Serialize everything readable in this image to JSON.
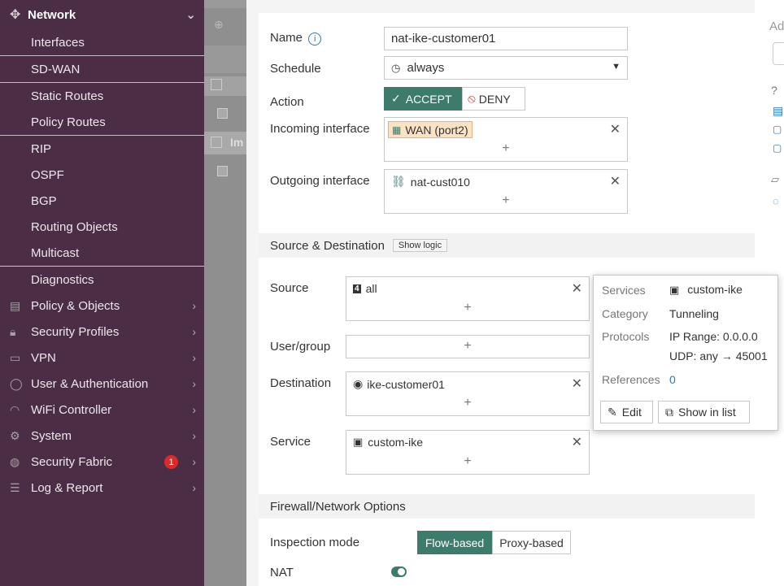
{
  "sidebar": {
    "section_title": "Network",
    "sub_items": [
      "Interfaces",
      "SD-WAN",
      "Static Routes",
      "Policy Routes",
      "RIP",
      "OSPF",
      "BGP",
      "Routing Objects",
      "Multicast",
      "Diagnostics"
    ],
    "top_items": [
      {
        "label": "Policy & Objects",
        "icon": "policy-icon"
      },
      {
        "label": "Security Profiles",
        "icon": "lock-icon"
      },
      {
        "label": "VPN",
        "icon": "monitor-icon"
      },
      {
        "label": "User & Authentication",
        "icon": "user-icon"
      },
      {
        "label": "WiFi Controller",
        "icon": "wifi-icon"
      },
      {
        "label": "System",
        "icon": "gear-icon"
      },
      {
        "label": "Security Fabric",
        "icon": "fabric-icon",
        "badge": "1"
      },
      {
        "label": "Log & Report",
        "icon": "log-icon"
      }
    ]
  },
  "background": {
    "partial_label": "Im"
  },
  "form": {
    "name_label": "Name",
    "name_value": "nat-ike-customer01",
    "schedule_label": "Schedule",
    "schedule_value": "always",
    "action_label": "Action",
    "accept_label": "ACCEPT",
    "deny_label": "DENY",
    "incoming_label": "Incoming interface",
    "incoming_value": "WAN (port2)",
    "outgoing_label": "Outgoing interface",
    "outgoing_value": "nat-cust010",
    "src_dst_section": "Source & Destination",
    "show_logic": "Show logic",
    "source_label": "Source",
    "source_value": "all",
    "usergroup_label": "User/group",
    "destination_label": "Destination",
    "destination_value": "ike-customer01",
    "service_label": "Service",
    "service_value": "custom-ike",
    "fw_section": "Firewall/Network Options",
    "inspection_label": "Inspection mode",
    "flow_label": "Flow-based",
    "proxy_label": "Proxy-based",
    "nat_label": "NAT",
    "nat_enabled": true
  },
  "popup": {
    "services_key": "Services",
    "services_val": "custom-ike",
    "category_key": "Category",
    "category_val": "Tunneling",
    "protocols_key": "Protocols",
    "protocols_line1": "IP Range: 0.0.0.0",
    "protocols_line2": "UDP: any → 45001",
    "references_key": "References",
    "references_val": "0",
    "edit_label": "Edit",
    "show_label": "Show in list"
  },
  "right": {
    "partial_label": "Ad"
  },
  "colors": {
    "sidebar_bg": "#4b2e45",
    "accent_green": "#3d7c6c",
    "link_blue": "#2a7ab8",
    "badge_red": "#da2b2b"
  }
}
